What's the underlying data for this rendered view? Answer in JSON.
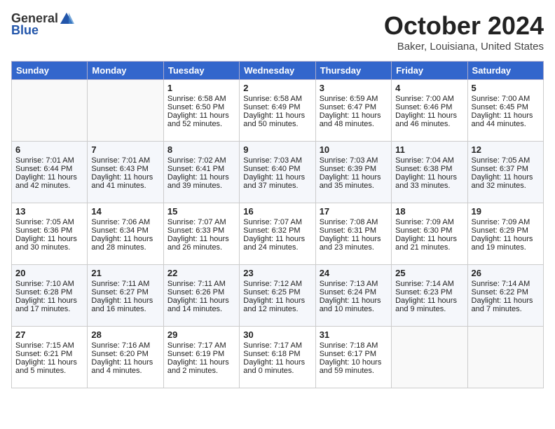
{
  "header": {
    "logo_line1": "General",
    "logo_line2": "Blue",
    "month": "October 2024",
    "location": "Baker, Louisiana, United States"
  },
  "weekdays": [
    "Sunday",
    "Monday",
    "Tuesday",
    "Wednesday",
    "Thursday",
    "Friday",
    "Saturday"
  ],
  "weeks": [
    [
      {
        "day": "",
        "info": ""
      },
      {
        "day": "",
        "info": ""
      },
      {
        "day": "1",
        "info": "Sunrise: 6:58 AM\nSunset: 6:50 PM\nDaylight: 11 hours and 52 minutes."
      },
      {
        "day": "2",
        "info": "Sunrise: 6:58 AM\nSunset: 6:49 PM\nDaylight: 11 hours and 50 minutes."
      },
      {
        "day": "3",
        "info": "Sunrise: 6:59 AM\nSunset: 6:47 PM\nDaylight: 11 hours and 48 minutes."
      },
      {
        "day": "4",
        "info": "Sunrise: 7:00 AM\nSunset: 6:46 PM\nDaylight: 11 hours and 46 minutes."
      },
      {
        "day": "5",
        "info": "Sunrise: 7:00 AM\nSunset: 6:45 PM\nDaylight: 11 hours and 44 minutes."
      }
    ],
    [
      {
        "day": "6",
        "info": "Sunrise: 7:01 AM\nSunset: 6:44 PM\nDaylight: 11 hours and 42 minutes."
      },
      {
        "day": "7",
        "info": "Sunrise: 7:01 AM\nSunset: 6:43 PM\nDaylight: 11 hours and 41 minutes."
      },
      {
        "day": "8",
        "info": "Sunrise: 7:02 AM\nSunset: 6:41 PM\nDaylight: 11 hours and 39 minutes."
      },
      {
        "day": "9",
        "info": "Sunrise: 7:03 AM\nSunset: 6:40 PM\nDaylight: 11 hours and 37 minutes."
      },
      {
        "day": "10",
        "info": "Sunrise: 7:03 AM\nSunset: 6:39 PM\nDaylight: 11 hours and 35 minutes."
      },
      {
        "day": "11",
        "info": "Sunrise: 7:04 AM\nSunset: 6:38 PM\nDaylight: 11 hours and 33 minutes."
      },
      {
        "day": "12",
        "info": "Sunrise: 7:05 AM\nSunset: 6:37 PM\nDaylight: 11 hours and 32 minutes."
      }
    ],
    [
      {
        "day": "13",
        "info": "Sunrise: 7:05 AM\nSunset: 6:36 PM\nDaylight: 11 hours and 30 minutes."
      },
      {
        "day": "14",
        "info": "Sunrise: 7:06 AM\nSunset: 6:34 PM\nDaylight: 11 hours and 28 minutes."
      },
      {
        "day": "15",
        "info": "Sunrise: 7:07 AM\nSunset: 6:33 PM\nDaylight: 11 hours and 26 minutes."
      },
      {
        "day": "16",
        "info": "Sunrise: 7:07 AM\nSunset: 6:32 PM\nDaylight: 11 hours and 24 minutes."
      },
      {
        "day": "17",
        "info": "Sunrise: 7:08 AM\nSunset: 6:31 PM\nDaylight: 11 hours and 23 minutes."
      },
      {
        "day": "18",
        "info": "Sunrise: 7:09 AM\nSunset: 6:30 PM\nDaylight: 11 hours and 21 minutes."
      },
      {
        "day": "19",
        "info": "Sunrise: 7:09 AM\nSunset: 6:29 PM\nDaylight: 11 hours and 19 minutes."
      }
    ],
    [
      {
        "day": "20",
        "info": "Sunrise: 7:10 AM\nSunset: 6:28 PM\nDaylight: 11 hours and 17 minutes."
      },
      {
        "day": "21",
        "info": "Sunrise: 7:11 AM\nSunset: 6:27 PM\nDaylight: 11 hours and 16 minutes."
      },
      {
        "day": "22",
        "info": "Sunrise: 7:11 AM\nSunset: 6:26 PM\nDaylight: 11 hours and 14 minutes."
      },
      {
        "day": "23",
        "info": "Sunrise: 7:12 AM\nSunset: 6:25 PM\nDaylight: 11 hours and 12 minutes."
      },
      {
        "day": "24",
        "info": "Sunrise: 7:13 AM\nSunset: 6:24 PM\nDaylight: 11 hours and 10 minutes."
      },
      {
        "day": "25",
        "info": "Sunrise: 7:14 AM\nSunset: 6:23 PM\nDaylight: 11 hours and 9 minutes."
      },
      {
        "day": "26",
        "info": "Sunrise: 7:14 AM\nSunset: 6:22 PM\nDaylight: 11 hours and 7 minutes."
      }
    ],
    [
      {
        "day": "27",
        "info": "Sunrise: 7:15 AM\nSunset: 6:21 PM\nDaylight: 11 hours and 5 minutes."
      },
      {
        "day": "28",
        "info": "Sunrise: 7:16 AM\nSunset: 6:20 PM\nDaylight: 11 hours and 4 minutes."
      },
      {
        "day": "29",
        "info": "Sunrise: 7:17 AM\nSunset: 6:19 PM\nDaylight: 11 hours and 2 minutes."
      },
      {
        "day": "30",
        "info": "Sunrise: 7:17 AM\nSunset: 6:18 PM\nDaylight: 11 hours and 0 minutes."
      },
      {
        "day": "31",
        "info": "Sunrise: 7:18 AM\nSunset: 6:17 PM\nDaylight: 10 hours and 59 minutes."
      },
      {
        "day": "",
        "info": ""
      },
      {
        "day": "",
        "info": ""
      }
    ]
  ]
}
